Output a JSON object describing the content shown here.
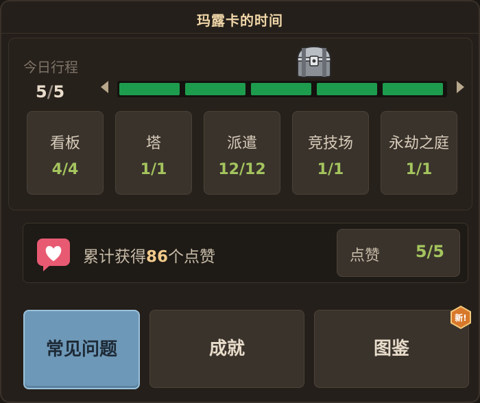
{
  "header": {
    "title": "玛露卡的时间"
  },
  "schedule": {
    "label": "今日行程",
    "current": "5",
    "slash": "/",
    "total": "5",
    "progress_filled": 5,
    "progress_segments": 5,
    "reward_icon": "treasure-chest-icon"
  },
  "activities": [
    {
      "label": "看板",
      "value": "4/4"
    },
    {
      "label": "塔",
      "value": "1/1"
    },
    {
      "label": "派遣",
      "value": "12/12"
    },
    {
      "label": "竞技场",
      "value": "1/1"
    },
    {
      "label": "永劫之庭",
      "value": "1/1"
    }
  ],
  "likes": {
    "prefix": "累计获得",
    "count": "86",
    "suffix": "个点赞",
    "button_label": "点赞",
    "button_value": "5/5",
    "icon": "heart-chat-icon"
  },
  "buttons": {
    "faq": "常见问题",
    "achievements": "成就",
    "collection": "图鉴"
  },
  "badge": {
    "new": "新!"
  },
  "colors": {
    "progress_fill": "#1e9c4e",
    "value_green": "#a4c45e",
    "faq_button": "#6e98b7",
    "title_gold": "#f0d6a8",
    "heart_pink": "#e85a72",
    "badge_orange": "#d8782a"
  }
}
